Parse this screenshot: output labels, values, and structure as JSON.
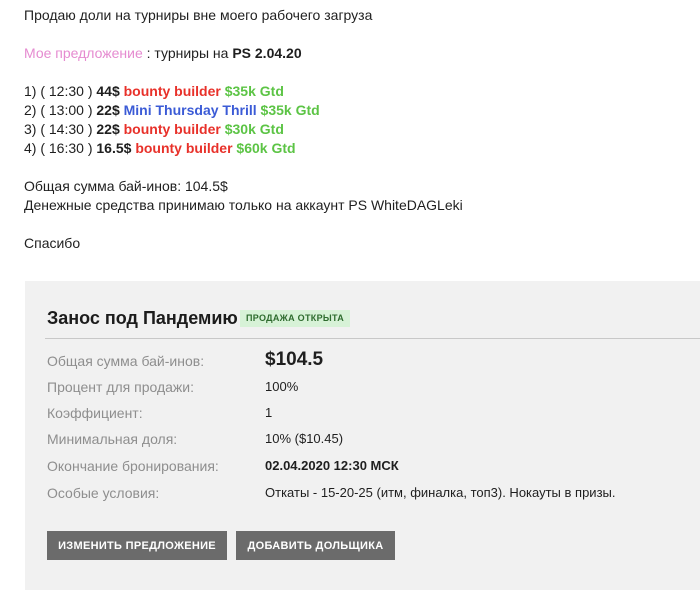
{
  "post": {
    "intro": "Продаю доли на турниры вне моего рабочего загруза",
    "offer_label": "Мое предложение",
    "offer_text": " : турниры на ",
    "offer_date": "PS 2.04.20",
    "tournaments": [
      {
        "prefix": "1) ( 12:30 ) ",
        "buyin": "44$",
        "name": "bounty builder",
        "name_color": "red",
        "gtd": "$35k Gtd"
      },
      {
        "prefix": "2) ( 13:00 ) ",
        "buyin": "22$",
        "name": "Mini Thursday Thrill",
        "name_color": "blue",
        "gtd": "$35k Gtd"
      },
      {
        "prefix": "3) ( 14:30 ) ",
        "buyin": "22$",
        "name": "bounty builder",
        "name_color": "red",
        "gtd": "$30k Gtd"
      },
      {
        "prefix": "4) ( 16:30 ) ",
        "buyin": "16.5$",
        "name": "bounty builder",
        "name_color": "red",
        "gtd": "$60k Gtd"
      }
    ],
    "total": "Общая сумма бай-инов: 104.5$",
    "payment": "Денежные средства принимаю только на аккаунт PS WhiteDAGLeki",
    "thanks": "Спасибо"
  },
  "card": {
    "title": "Занос под Пандемию",
    "badge": "ПРОДАЖА ОТКРЫТА",
    "rows": [
      {
        "label": "Общая сумма бай-инов:",
        "value": "$104.5"
      },
      {
        "label": "Процент для продажи:",
        "value": "100%"
      },
      {
        "label": "Коэффициент:",
        "value": "1"
      },
      {
        "label": "Минимальная доля:",
        "value": "10% ($10.45)"
      },
      {
        "label": "Окончание бронирования:",
        "value": "02.04.2020 12:30 МСК"
      },
      {
        "label": "Особые условия:",
        "value": "Откаты - 15-20-25 (итм, финалка, топ3). Нокауты в призы."
      }
    ],
    "buttons": {
      "edit": "ИЗМЕНИТЬ ПРЕДЛОЖЕНИЕ",
      "add": "ДОБАВИТЬ ДОЛЬЩИКА"
    },
    "colors": {
      "badge_bg": "#d7f2d7",
      "badge_text": "#2e6b2e",
      "button_bg": "#6b6b6b",
      "card_bg": "#f1f1f1"
    }
  },
  "colors": {
    "pink": "#e58bd0",
    "red": "#e8312a",
    "blue": "#3b5bd6",
    "green": "#5cc445"
  }
}
